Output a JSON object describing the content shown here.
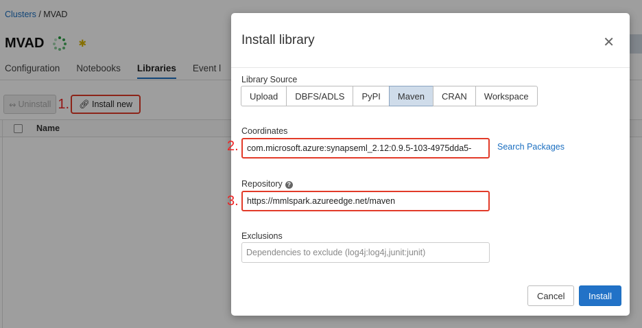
{
  "breadcrumb": {
    "parent": "Clusters",
    "separator": " / ",
    "current": "MVAD"
  },
  "page": {
    "title": "MVAD"
  },
  "tabs": [
    {
      "label": "Configuration"
    },
    {
      "label": "Notebooks"
    },
    {
      "label": "Libraries",
      "active": true
    },
    {
      "label": "Event l"
    }
  ],
  "toolbar": {
    "uninstall_label": "Uninstall",
    "install_new_label": "Install new",
    "step1": "1."
  },
  "table": {
    "columns": [
      "Name"
    ]
  },
  "modal": {
    "title": "Install library",
    "library_source_label": "Library Source",
    "sources": [
      "Upload",
      "DBFS/ADLS",
      "PyPI",
      "Maven",
      "CRAN",
      "Workspace"
    ],
    "selected_source": "Maven",
    "coordinates_label": "Coordinates",
    "coordinates_value": "com.microsoft.azure:synapseml_2.12:0.9.5-103-4975dda5-",
    "search_packages_label": "Search Packages",
    "repository_label": "Repository",
    "repository_value": "https://mmlspark.azureedge.net/maven",
    "exclusions_label": "Exclusions",
    "exclusions_placeholder": "Dependencies to exclude (log4j:log4j,junit:junit)",
    "step2": "2.",
    "step3": "3.",
    "cancel_label": "Cancel",
    "install_label": "Install"
  },
  "colors": {
    "accent": "#2272c7",
    "highlight": "#e23a28",
    "running": "#1d9a3a"
  },
  "icons": {
    "status": "spinner-icon",
    "pin": "pin-icon",
    "close": "close-icon",
    "help": "help-icon",
    "link": "link-icon"
  }
}
